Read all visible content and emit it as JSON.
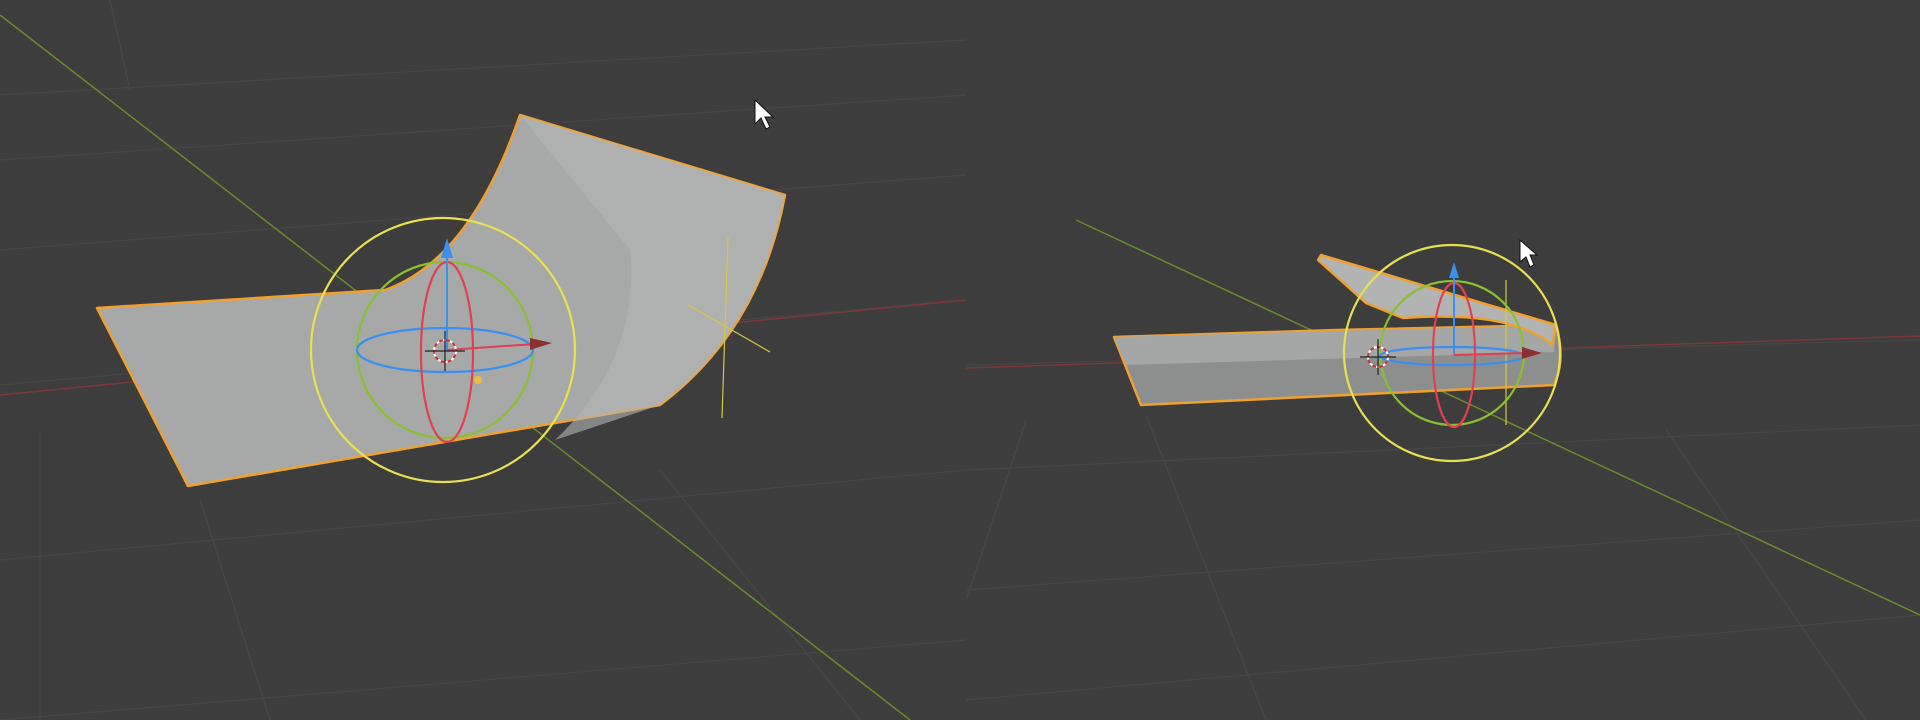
{
  "app": {
    "name": "3D viewport"
  },
  "viewports": [
    {
      "id": "left",
      "description_key": "perspective-view",
      "selected_object": "curved-plane",
      "gizmo": "rotate"
    },
    {
      "id": "right",
      "description_key": "side-view",
      "selected_object": "folded-plane",
      "gizmo": "rotate"
    }
  ],
  "colors": {
    "background": "#3d3d3d",
    "grid": "#474747",
    "axis_x": "#8a3a3a",
    "axis_y": "#6b8a2a",
    "selection_outline": "#f0a030",
    "gizmo_x": "#e04050",
    "gizmo_y": "#8ac030",
    "gizmo_z": "#3a90f0",
    "gizmo_view": "#e8e050",
    "mesh_face": "#a7a9a8"
  },
  "icons": [
    "mouse-cursor-icon",
    "3d-cursor-icon",
    "rotate-gizmo-icon"
  ]
}
